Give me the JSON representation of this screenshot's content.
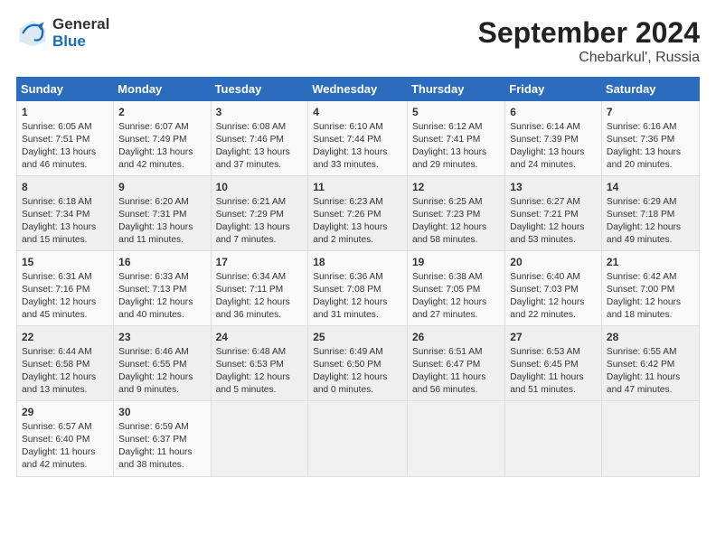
{
  "header": {
    "logo_general": "General",
    "logo_blue": "Blue",
    "title": "September 2024",
    "location": "Chebarkul', Russia"
  },
  "days_of_week": [
    "Sunday",
    "Monday",
    "Tuesday",
    "Wednesday",
    "Thursday",
    "Friday",
    "Saturday"
  ],
  "weeks": [
    [
      {
        "day": "1",
        "info": "Sunrise: 6:05 AM\nSunset: 7:51 PM\nDaylight: 13 hours\nand 46 minutes."
      },
      {
        "day": "2",
        "info": "Sunrise: 6:07 AM\nSunset: 7:49 PM\nDaylight: 13 hours\nand 42 minutes."
      },
      {
        "day": "3",
        "info": "Sunrise: 6:08 AM\nSunset: 7:46 PM\nDaylight: 13 hours\nand 37 minutes."
      },
      {
        "day": "4",
        "info": "Sunrise: 6:10 AM\nSunset: 7:44 PM\nDaylight: 13 hours\nand 33 minutes."
      },
      {
        "day": "5",
        "info": "Sunrise: 6:12 AM\nSunset: 7:41 PM\nDaylight: 13 hours\nand 29 minutes."
      },
      {
        "day": "6",
        "info": "Sunrise: 6:14 AM\nSunset: 7:39 PM\nDaylight: 13 hours\nand 24 minutes."
      },
      {
        "day": "7",
        "info": "Sunrise: 6:16 AM\nSunset: 7:36 PM\nDaylight: 13 hours\nand 20 minutes."
      }
    ],
    [
      {
        "day": "8",
        "info": "Sunrise: 6:18 AM\nSunset: 7:34 PM\nDaylight: 13 hours\nand 15 minutes."
      },
      {
        "day": "9",
        "info": "Sunrise: 6:20 AM\nSunset: 7:31 PM\nDaylight: 13 hours\nand 11 minutes."
      },
      {
        "day": "10",
        "info": "Sunrise: 6:21 AM\nSunset: 7:29 PM\nDaylight: 13 hours\nand 7 minutes."
      },
      {
        "day": "11",
        "info": "Sunrise: 6:23 AM\nSunset: 7:26 PM\nDaylight: 13 hours\nand 2 minutes."
      },
      {
        "day": "12",
        "info": "Sunrise: 6:25 AM\nSunset: 7:23 PM\nDaylight: 12 hours\nand 58 minutes."
      },
      {
        "day": "13",
        "info": "Sunrise: 6:27 AM\nSunset: 7:21 PM\nDaylight: 12 hours\nand 53 minutes."
      },
      {
        "day": "14",
        "info": "Sunrise: 6:29 AM\nSunset: 7:18 PM\nDaylight: 12 hours\nand 49 minutes."
      }
    ],
    [
      {
        "day": "15",
        "info": "Sunrise: 6:31 AM\nSunset: 7:16 PM\nDaylight: 12 hours\nand 45 minutes."
      },
      {
        "day": "16",
        "info": "Sunrise: 6:33 AM\nSunset: 7:13 PM\nDaylight: 12 hours\nand 40 minutes."
      },
      {
        "day": "17",
        "info": "Sunrise: 6:34 AM\nSunset: 7:11 PM\nDaylight: 12 hours\nand 36 minutes."
      },
      {
        "day": "18",
        "info": "Sunrise: 6:36 AM\nSunset: 7:08 PM\nDaylight: 12 hours\nand 31 minutes."
      },
      {
        "day": "19",
        "info": "Sunrise: 6:38 AM\nSunset: 7:05 PM\nDaylight: 12 hours\nand 27 minutes."
      },
      {
        "day": "20",
        "info": "Sunrise: 6:40 AM\nSunset: 7:03 PM\nDaylight: 12 hours\nand 22 minutes."
      },
      {
        "day": "21",
        "info": "Sunrise: 6:42 AM\nSunset: 7:00 PM\nDaylight: 12 hours\nand 18 minutes."
      }
    ],
    [
      {
        "day": "22",
        "info": "Sunrise: 6:44 AM\nSunset: 6:58 PM\nDaylight: 12 hours\nand 13 minutes."
      },
      {
        "day": "23",
        "info": "Sunrise: 6:46 AM\nSunset: 6:55 PM\nDaylight: 12 hours\nand 9 minutes."
      },
      {
        "day": "24",
        "info": "Sunrise: 6:48 AM\nSunset: 6:53 PM\nDaylight: 12 hours\nand 5 minutes."
      },
      {
        "day": "25",
        "info": "Sunrise: 6:49 AM\nSunset: 6:50 PM\nDaylight: 12 hours\nand 0 minutes."
      },
      {
        "day": "26",
        "info": "Sunrise: 6:51 AM\nSunset: 6:47 PM\nDaylight: 11 hours\nand 56 minutes."
      },
      {
        "day": "27",
        "info": "Sunrise: 6:53 AM\nSunset: 6:45 PM\nDaylight: 11 hours\nand 51 minutes."
      },
      {
        "day": "28",
        "info": "Sunrise: 6:55 AM\nSunset: 6:42 PM\nDaylight: 11 hours\nand 47 minutes."
      }
    ],
    [
      {
        "day": "29",
        "info": "Sunrise: 6:57 AM\nSunset: 6:40 PM\nDaylight: 11 hours\nand 42 minutes."
      },
      {
        "day": "30",
        "info": "Sunrise: 6:59 AM\nSunset: 6:37 PM\nDaylight: 11 hours\nand 38 minutes."
      },
      {
        "day": "",
        "info": ""
      },
      {
        "day": "",
        "info": ""
      },
      {
        "day": "",
        "info": ""
      },
      {
        "day": "",
        "info": ""
      },
      {
        "day": "",
        "info": ""
      }
    ]
  ]
}
